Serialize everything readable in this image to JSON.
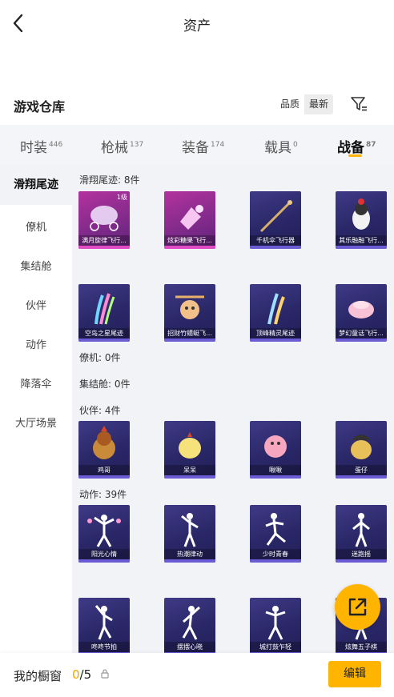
{
  "header": {
    "title": "资产"
  },
  "warehouse": {
    "title": "游戏仓库",
    "sort_quality": "品质",
    "sort_latest": "最新"
  },
  "tabs": [
    {
      "label": "时装",
      "count": "446"
    },
    {
      "label": "枪械",
      "count": "137"
    },
    {
      "label": "装备",
      "count": "174"
    },
    {
      "label": "载具",
      "count": "0"
    },
    {
      "label": "战备",
      "count": "87"
    }
  ],
  "sidebar": [
    {
      "label": "滑翔尾迹"
    },
    {
      "label": "僚机"
    },
    {
      "label": "集结舱"
    },
    {
      "label": "伙伴"
    },
    {
      "label": "动作"
    },
    {
      "label": "降落伞"
    },
    {
      "label": "大厅场景"
    }
  ],
  "sections": {
    "trail": "滑翔尾迹: 8件",
    "wingman": "僚机: 0件",
    "pod": "集结舱: 0件",
    "partner": "伙伴: 4件",
    "action": "动作: 39件"
  },
  "trail_items": [
    {
      "name": "满月旋律飞行...",
      "level": "1级",
      "rarity": "pink"
    },
    {
      "name": "炫彩糖果飞行...",
      "level": "",
      "rarity": "pink"
    },
    {
      "name": "千机伞飞行器",
      "level": "",
      "rarity": "purple"
    },
    {
      "name": "其乐融融飞行...",
      "level": "",
      "rarity": "purple"
    },
    {
      "name": "空岛之星尾迹",
      "level": "",
      "rarity": "purple"
    },
    {
      "name": "招财竹蜻蜓飞...",
      "level": "",
      "rarity": "purple"
    },
    {
      "name": "顶峰精灵尾迹",
      "level": "",
      "rarity": "purple"
    },
    {
      "name": "梦幻童话飞行...",
      "level": "",
      "rarity": "purple"
    }
  ],
  "partner_items": [
    {
      "name": "鸡哥"
    },
    {
      "name": "呆呆"
    },
    {
      "name": "啾啾"
    },
    {
      "name": "蛋仔"
    }
  ],
  "action_items": [
    {
      "name": "阳光心情"
    },
    {
      "name": "热潮律动"
    },
    {
      "name": "少时青春"
    },
    {
      "name": "迷跑摇"
    },
    {
      "name": "咚咚节拍"
    },
    {
      "name": "摆摆心晓"
    },
    {
      "name": "城打鼓乍轻"
    },
    {
      "name": "炫舞五子棋"
    }
  ],
  "showcase": {
    "label": "我的橱窗",
    "current": "0",
    "total": "/5",
    "edit_label": "编辑"
  },
  "colors": {
    "accent": "#ffb400",
    "card_purple": "#2a2768",
    "card_pink": "#b3329e"
  },
  "icons": [
    "back-arrow-icon",
    "filter-icon",
    "lock-icon",
    "external-link-icon"
  ]
}
